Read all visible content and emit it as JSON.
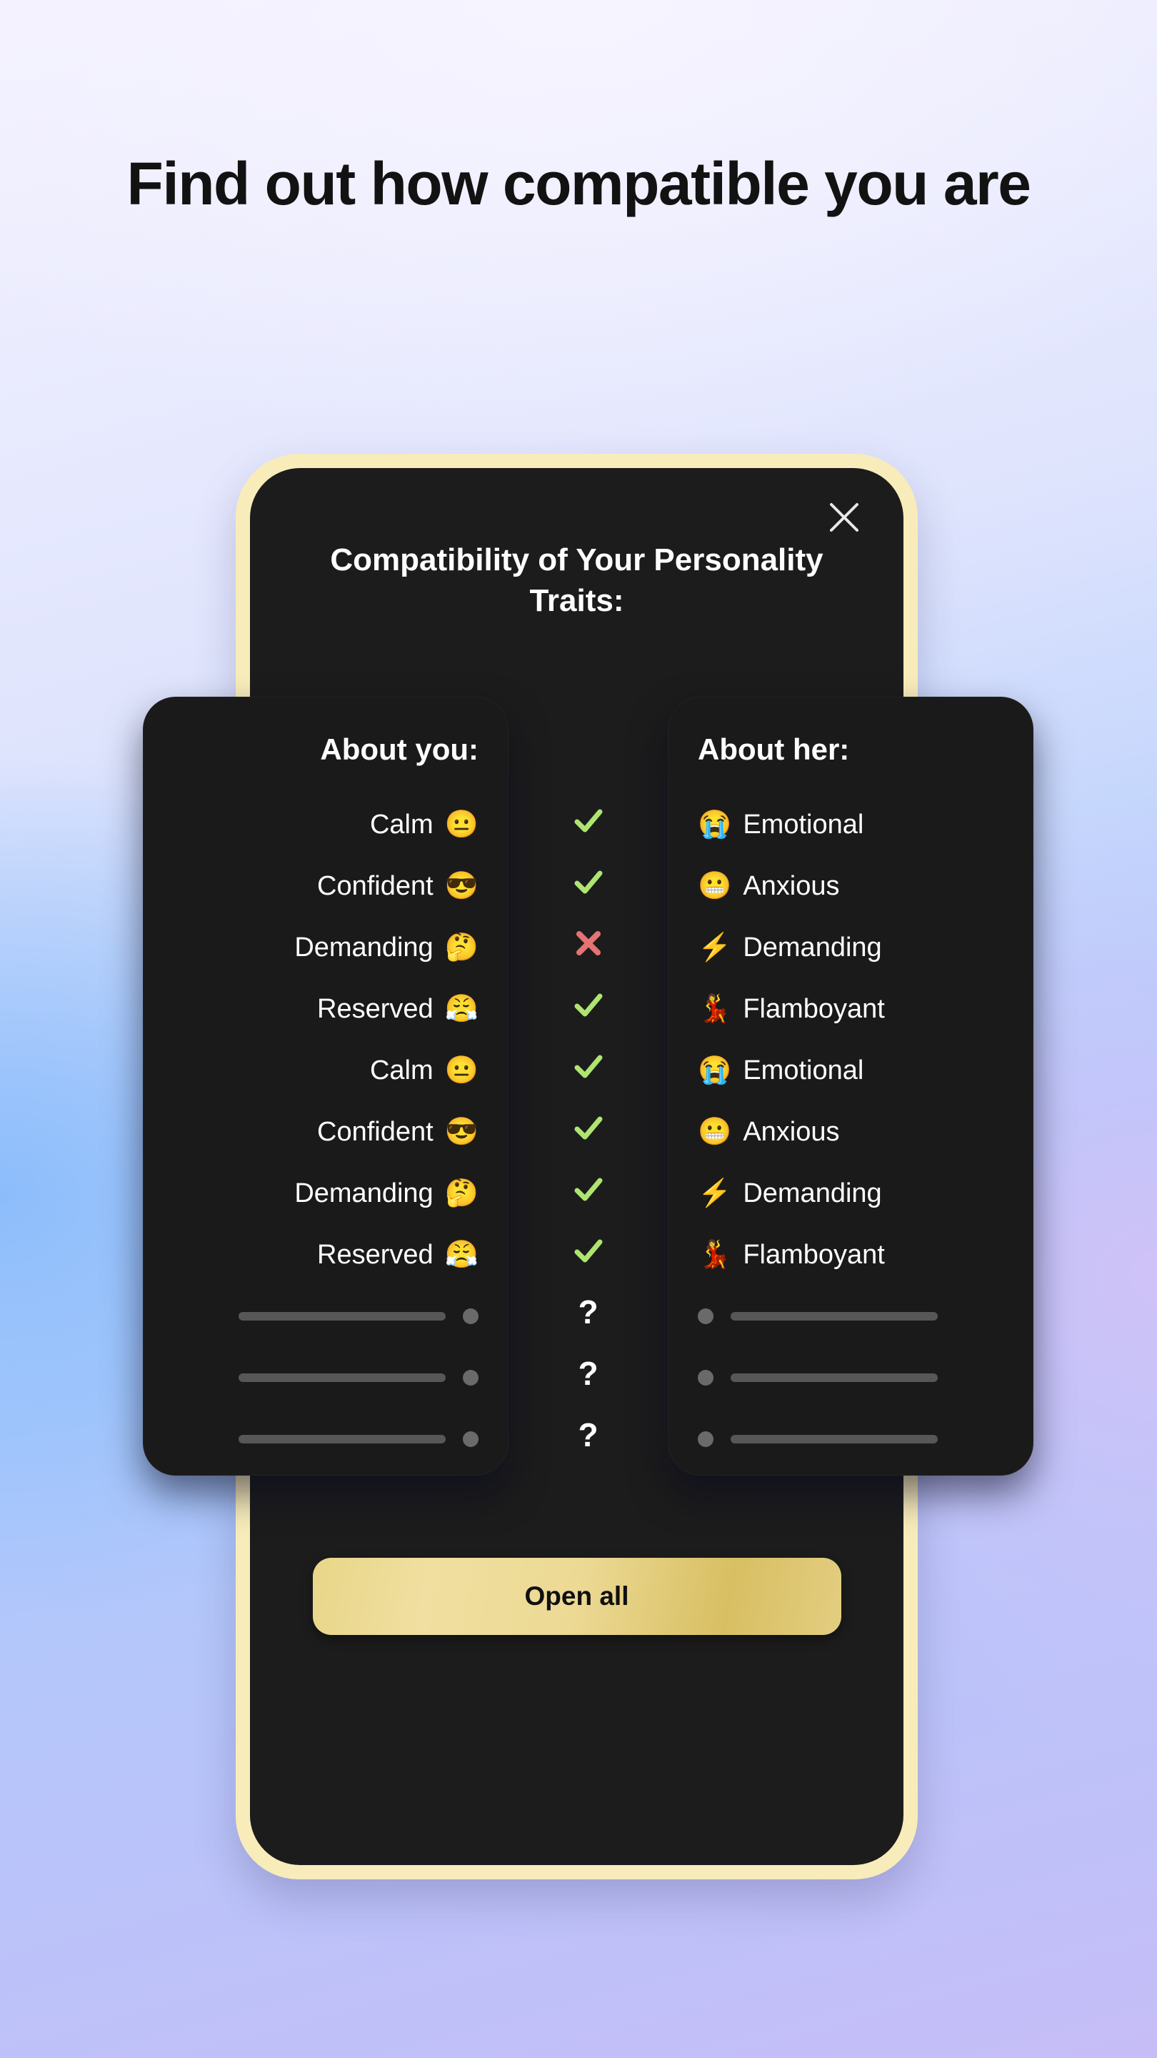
{
  "headline": "Find out how compatible you are",
  "colors": {
    "phone_frame": "#f8ecbb",
    "screen": "#1c1c1c",
    "card": "#1a1a1a",
    "match_green": "#aee571",
    "mismatch_red": "#e57373",
    "button_gold": "#ecd994",
    "bg_blue": "#8cbdfb",
    "bg_lavender": "#cfc2f8"
  },
  "modal": {
    "title": "Compatibility of Your Personality Traits:",
    "close_icon": "close-icon",
    "open_all_label": "Open all"
  },
  "cards": {
    "you": {
      "heading": "About you:",
      "traits": [
        {
          "label": "Calm",
          "emoji": "😐",
          "emoji_name": "neutral-face-emoji"
        },
        {
          "label": "Confident",
          "emoji": "😎",
          "emoji_name": "sunglasses-face-emoji"
        },
        {
          "label": "Demanding",
          "emoji": "🤔",
          "emoji_name": "thinking-face-emoji"
        },
        {
          "label": "Reserved",
          "emoji": "😤",
          "emoji_name": "steam-nose-face-emoji"
        },
        {
          "label": "Calm",
          "emoji": "😐",
          "emoji_name": "neutral-face-emoji"
        },
        {
          "label": "Confident",
          "emoji": "😎",
          "emoji_name": "sunglasses-face-emoji"
        },
        {
          "label": "Demanding",
          "emoji": "🤔",
          "emoji_name": "thinking-face-emoji"
        },
        {
          "label": "Reserved",
          "emoji": "😤",
          "emoji_name": "steam-nose-face-emoji"
        }
      ],
      "locked_rows": 3
    },
    "her": {
      "heading": "About her:",
      "traits": [
        {
          "label": "Emotional",
          "emoji": "😭",
          "emoji_name": "loudly-crying-face-emoji"
        },
        {
          "label": "Anxious",
          "emoji": "😬",
          "emoji_name": "grimacing-face-emoji"
        },
        {
          "label": "Demanding",
          "emoji": "⚡",
          "emoji_name": "lightning-bolt-emoji"
        },
        {
          "label": "Flamboyant",
          "emoji": "💃",
          "emoji_name": "woman-dancing-emoji"
        },
        {
          "label": "Emotional",
          "emoji": "😭",
          "emoji_name": "loudly-crying-face-emoji"
        },
        {
          "label": "Anxious",
          "emoji": "😬",
          "emoji_name": "grimacing-face-emoji"
        },
        {
          "label": "Demanding",
          "emoji": "⚡",
          "emoji_name": "lightning-bolt-emoji"
        },
        {
          "label": "Flamboyant",
          "emoji": "💃",
          "emoji_name": "woman-dancing-emoji"
        }
      ],
      "locked_rows": 3
    }
  },
  "verdicts": [
    {
      "type": "match",
      "icon": "check-icon"
    },
    {
      "type": "match",
      "icon": "check-icon"
    },
    {
      "type": "mismatch",
      "icon": "cross-icon"
    },
    {
      "type": "match",
      "icon": "check-icon"
    },
    {
      "type": "match",
      "icon": "check-icon"
    },
    {
      "type": "match",
      "icon": "check-icon"
    },
    {
      "type": "match",
      "icon": "check-icon"
    },
    {
      "type": "match",
      "icon": "check-icon"
    }
  ],
  "locked_verdicts": [
    "?",
    "?",
    "?"
  ]
}
